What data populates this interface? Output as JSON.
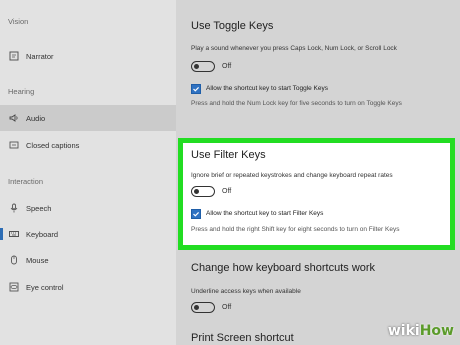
{
  "sidebar": {
    "headings": {
      "vision": "Vision",
      "hearing": "Hearing",
      "interaction": "Interaction"
    },
    "items": [
      {
        "label": "Narrator",
        "icon": "narrator-icon"
      },
      {
        "label": "Audio",
        "icon": "speaker-icon"
      },
      {
        "label": "Closed captions",
        "icon": "captions-icon"
      },
      {
        "label": "Speech",
        "icon": "microphone-icon"
      },
      {
        "label": "Keyboard",
        "icon": "keyboard-icon"
      },
      {
        "label": "Mouse",
        "icon": "mouse-icon"
      },
      {
        "label": "Eye control",
        "icon": "eye-control-icon"
      }
    ]
  },
  "toggle_keys": {
    "title": "Use Toggle Keys",
    "description": "Play a sound whenever you press Caps Lock, Num Lock, or Scroll Lock",
    "toggle_state": "Off",
    "checkbox_label": "Allow the shortcut key to start Toggle Keys",
    "checkbox_help": "Press and hold the Num Lock key for five seconds to turn on Toggle Keys"
  },
  "filter_keys": {
    "title": "Use Filter Keys",
    "description": "Ignore brief or repeated keystrokes and change keyboard repeat rates",
    "toggle_state": "Off",
    "checkbox_label": "Allow the shortcut key to start Filter Keys",
    "checkbox_help": "Press and hold the right Shift key for eight seconds to turn on Filter Keys"
  },
  "shortcuts": {
    "title": "Change how keyboard shortcuts work",
    "description": "Underline access keys when available",
    "toggle_state": "Off"
  },
  "print_screen": {
    "title": "Print Screen shortcut"
  },
  "watermark": {
    "part1": "wiki",
    "part2": "How"
  },
  "colors": {
    "accent": "#2f72c2",
    "highlight": "#22dd22",
    "watermark_green": "#5b9b2a"
  }
}
